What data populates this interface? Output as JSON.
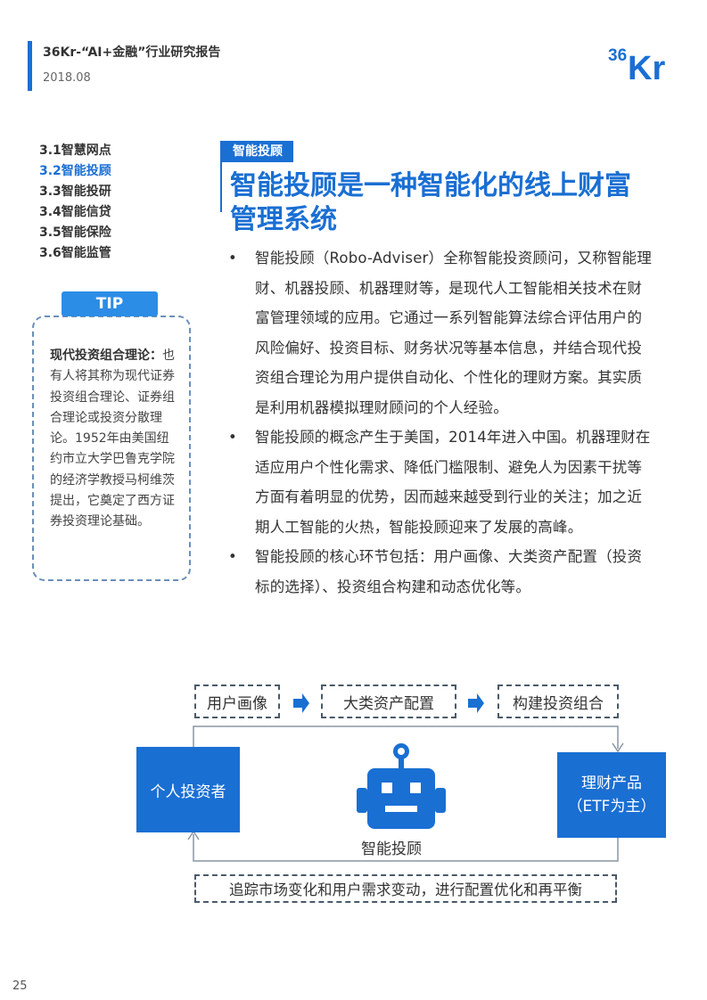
{
  "header": {
    "title": "36Kr-“AI+金融”行业研究报告",
    "date": "2018.08",
    "logo_text": "36Kr",
    "accent_color": "#1a6fd3"
  },
  "toc": {
    "items": [
      "3.1智慧网点",
      "3.2智能投顾",
      "3.3智能投研",
      "3.4智能信贷",
      "3.5智能保险",
      "3.6智能监管"
    ],
    "active_index": 1
  },
  "tip": {
    "label": "TIP",
    "term": "现代投资组合理论：",
    "body": "也有人将其称为现代证券投资组合理论、证券组合理论或投资分散理论。1952年由美国纽约市立大学巴鲁克学院的经济学教授马柯维茨提出，它奠定了西方证券投资理论基础。"
  },
  "section": {
    "tag": "智能投顾",
    "title": "智能投顾是一种智能化的线上财富管理系统"
  },
  "bullets": [
    "智能投顾（Robo-Adviser）全称智能投资顾问，又称智能理财、机器投顾、机器理财等，是现代人工智能相关技术在财富管理领域的应用。它通过一系列智能算法综合评估用户的风险偏好、投资目标、财务状况等基本信息，并结合现代投资组合理论为用户提供自动化、个性化的理财方案。其实质是利用机器模拟理财顾问的个人经验。",
    "智能投顾的概念产生于美国，2014年进入中国。机器理财在适应用户个性化需求、降低门槛限制、避免人为因素干扰等方面有着明显的优势，因而越来越受到行业的关注；加之近期人工智能的火热，智能投顾迎来了发展的高峰。",
    "智能投顾的核心环节包括：用户画像、大类资产配置（投资标的选择）、投资组合构建和动态优化等。"
  ],
  "diagram": {
    "steps": [
      "用户画像",
      "大类资产配置",
      "构建投资组合"
    ],
    "left_box": "个人投资者",
    "right_box_line1": "理财产品",
    "right_box_line2": "（ETF为主）",
    "center_label": "智能投顾",
    "bottom_box": "追踪市场变化和用户需求变动，进行配置优化和再平衡"
  },
  "page_number": "25"
}
